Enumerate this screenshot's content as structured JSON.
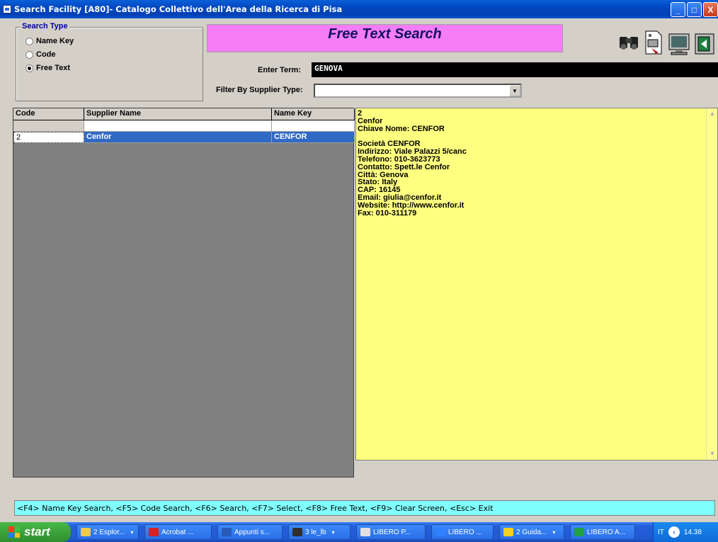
{
  "window": {
    "title": "Search Facility [A80]- Catalogo Collettivo dell'Area della Ricerca di Pisa",
    "minimize": "_",
    "maximize": "□",
    "close": "X"
  },
  "search_type": {
    "legend": "Search Type",
    "options": [
      {
        "label": "Name Key",
        "checked": false
      },
      {
        "label": "Code",
        "checked": false
      },
      {
        "label": "Free Text",
        "checked": true
      }
    ]
  },
  "banner": {
    "title": "Free Text Search"
  },
  "toolbar": {
    "icons": [
      "binoculars-icon",
      "document-export-icon",
      "monitor-icon",
      "exit-icon"
    ]
  },
  "form": {
    "enter_term_label": "Enter Term:",
    "enter_term_value": "GENOVA",
    "filter_label": "Filter By Supplier Type:",
    "filter_value": ""
  },
  "grid": {
    "columns": [
      "Code",
      "Supplier Name",
      "Name Key"
    ],
    "rows": [
      {
        "code": "",
        "name": "",
        "key": ""
      },
      {
        "code": "2",
        "name": "Cenfor",
        "key": "CENFOR"
      }
    ]
  },
  "detail": {
    "lines": [
      "2",
      "Cenfor",
      "Chiave Nome: CENFOR",
      "",
      "Società CENFOR",
      "Indirizzo: Viale Palazzi 5/canc",
      "Telefono: 010-3623773",
      "Contatto: Spett.le Cenfor",
      "Città: Genova",
      "Stato: Italy",
      "CAP: 16145",
      "Email: giulia@cenfor.it",
      "Website: http://www.cenfor.it",
      "Fax: 010-311179"
    ]
  },
  "statusbar": {
    "text": "<F4> Name Key Search, <F5> Code Search, <F6> Search, <F7> Select, <F8> Free Text, <F9> Clear Screen, <Esc> Exit"
  },
  "taskbar": {
    "start": "start",
    "tasks": [
      {
        "label": "2 Esplor...",
        "icon": "folder-icon",
        "color": "#f0c850",
        "dropdown": true
      },
      {
        "label": "Acrobat ...",
        "icon": "acrobat-icon",
        "color": "#d82020",
        "dropdown": false
      },
      {
        "label": "Appunti s...",
        "icon": "word-icon",
        "color": "#2a5ab8",
        "dropdown": false
      },
      {
        "label": "3 le_lb",
        "icon": "app-icon",
        "color": "#303030",
        "dropdown": true
      },
      {
        "label": "LIBERO P...",
        "icon": "search-app-icon",
        "color": "#e0e0e0",
        "dropdown": false
      },
      {
        "label": "LIBERO ...",
        "icon": "libero-icon",
        "color": "#3080ff",
        "dropdown": false
      },
      {
        "label": "2 Guida...",
        "icon": "help-icon",
        "color": "#f0d020",
        "dropdown": true
      },
      {
        "label": "LIBERO A...",
        "icon": "libero-books-icon",
        "color": "#20a040",
        "dropdown": false
      }
    ],
    "tray": {
      "lang": "IT",
      "time": "14.38"
    }
  }
}
